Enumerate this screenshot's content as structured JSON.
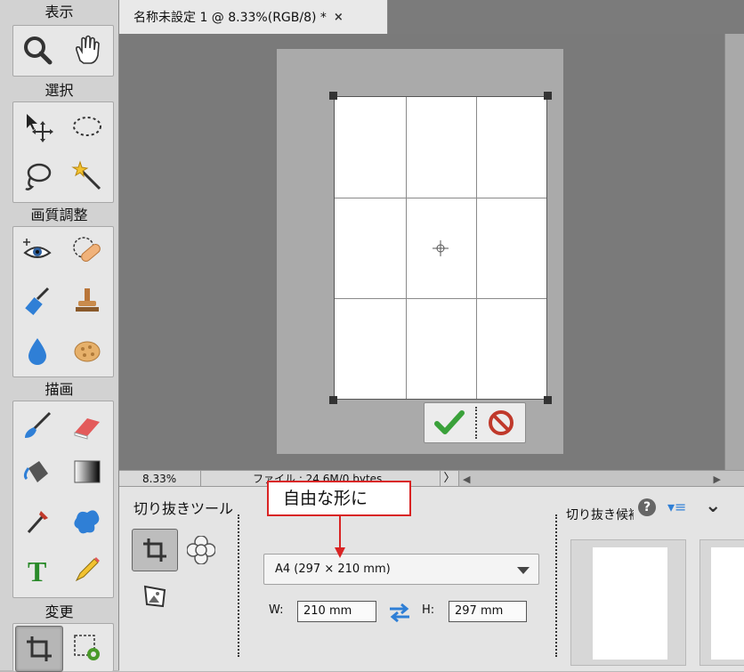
{
  "toolbox": {
    "sections": {
      "view": "表示",
      "select": "選択",
      "enhance": "画質調整",
      "draw": "描画",
      "modify": "変更"
    }
  },
  "document": {
    "tab_title": "名称未設定 1 @ 8.33%(RGB/8) *",
    "close_glyph": "×"
  },
  "statusbar": {
    "zoom": "8.33%",
    "file_info": "ファイル : 24.6M/0 bytes",
    "arrow": "〉"
  },
  "options": {
    "title": "切り抜きツール",
    "preset": "A4 (297 × 210 mm)",
    "width_label": "W:",
    "width_value": "210 mm",
    "height_label": "H:",
    "height_value": "297 mm",
    "suggestions_title": "切り抜き候補",
    "help_glyph": "?",
    "menu_glyph": "▾≡",
    "collapse_glyph": "⌄"
  },
  "annotation": {
    "text": "自由な形に",
    "color": "#d92323"
  },
  "colors": {
    "accent_blue": "#2f7fd6",
    "commit_green": "#3aa13a",
    "cancel_red": "#c0392b"
  }
}
